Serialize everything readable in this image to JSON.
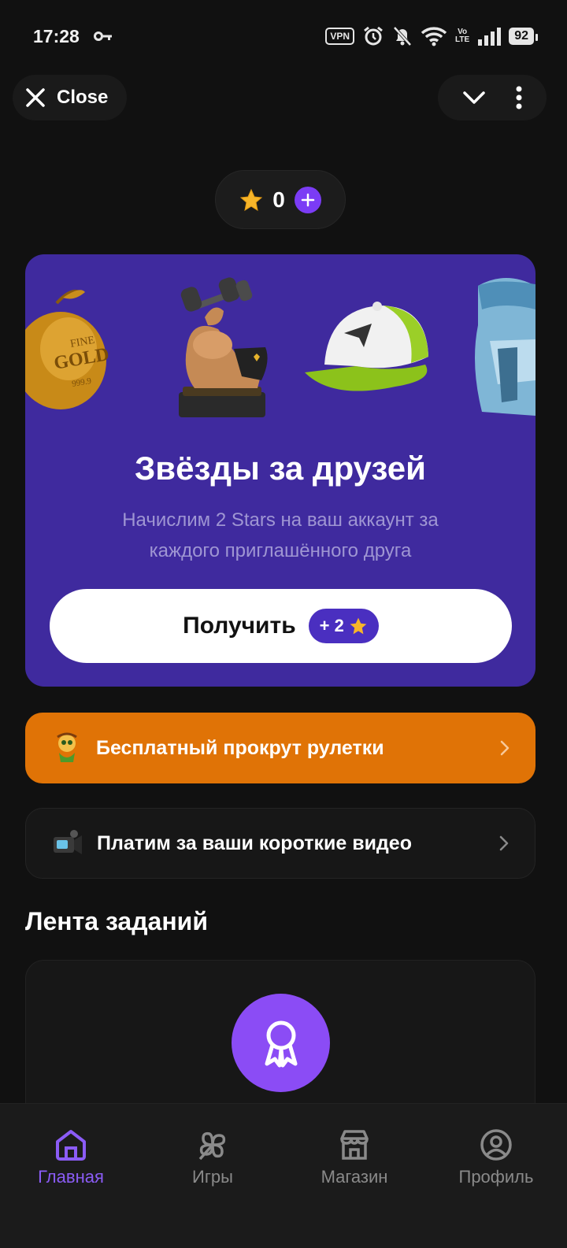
{
  "status_bar": {
    "time": "17:28",
    "vpn": "VPN",
    "volte_top": "Vo",
    "volte_bottom": "LTE",
    "battery": "92"
  },
  "header": {
    "close_label": "Close"
  },
  "balance": {
    "value": "0"
  },
  "promo": {
    "title": "Звёзды за друзей",
    "subtitle": "Начислим 2 Stars на ваш аккаунт за каждого приглашённого друга",
    "button_label": "Получить",
    "badge_text": "+ 2",
    "gold_text_1": "FINE",
    "gold_text_2": "GOLD",
    "gold_text_3": "999.9"
  },
  "rows": [
    {
      "label": "Бесплатный прокрут рулетки"
    },
    {
      "label": "Платим за ваши короткие видео"
    }
  ],
  "feed": {
    "title": "Лента заданий"
  },
  "nav": {
    "items": [
      {
        "label": "Главная"
      },
      {
        "label": "Игры"
      },
      {
        "label": "Магазин"
      },
      {
        "label": "Профиль"
      }
    ]
  },
  "colors": {
    "background": "#111111",
    "promo": "#3f2a9e",
    "accent": "#8b5cf6",
    "orange": "#e07306"
  }
}
